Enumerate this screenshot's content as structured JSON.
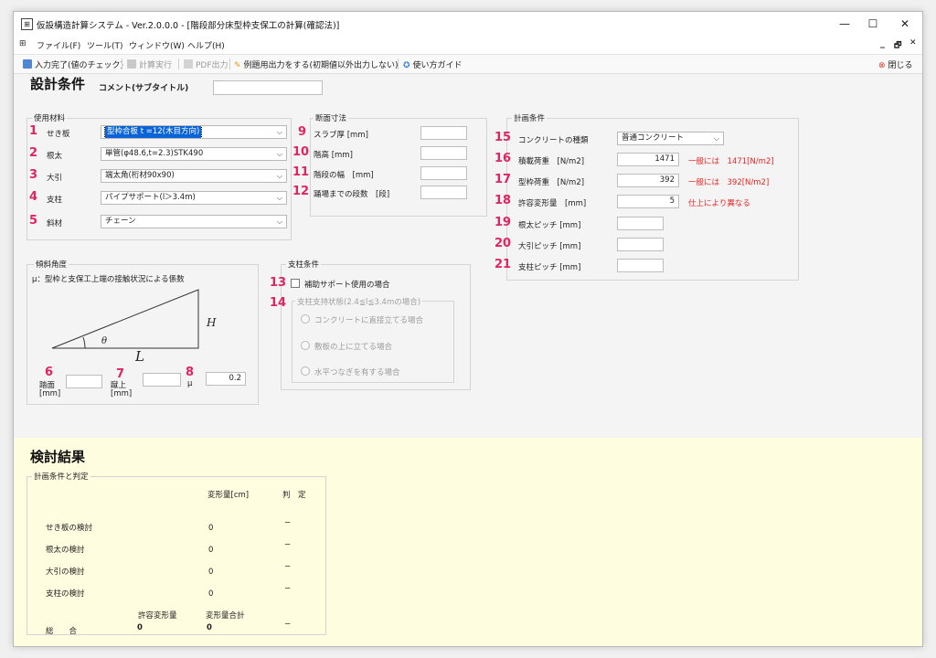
{
  "window": {
    "title": "仮設構造計算システム - Ver.2.0.0.0 - [階段部分床型枠支保工の計算(確認法)]",
    "minimize": "—",
    "maximize": "☐",
    "close": "✕"
  },
  "menu": {
    "items": [
      "ファイル(F)",
      "ツール(T)",
      "ウィンドウ(W)",
      "ヘルプ(H)"
    ],
    "right_min": "_",
    "right_restore": "🗗",
    "right_close": "✕"
  },
  "toolbar": {
    "input_done": "入力完了(値のチェック)",
    "calc_run": "計算実行",
    "pdf_out": "PDF出力",
    "example_out": "例題用出力をする(初期値以外出力しない)",
    "usage_guide": "使い方ガイド",
    "close": "閉じる"
  },
  "design": {
    "heading": "設計条件",
    "comment_label": "コメント(サブタイトル)",
    "comment_value": ""
  },
  "materials": {
    "group_title": "使用材料",
    "rows": [
      {
        "num": "1",
        "label": "せき板",
        "value": "型枠合板 t =12(木目方向)"
      },
      {
        "num": "2",
        "label": "根太",
        "value": "単管(φ48.6,t=2.3)STK490"
      },
      {
        "num": "3",
        "label": "大引",
        "value": "端太角(桁材90x90)"
      },
      {
        "num": "4",
        "label": "支柱",
        "value": "パイプサポート(l＞3.4m)"
      },
      {
        "num": "5",
        "label": "斜材",
        "value": "チェーン"
      }
    ]
  },
  "section": {
    "group_title": "断面寸法",
    "rows": [
      {
        "num": "9",
        "label": "スラブ厚 [mm]",
        "value": ""
      },
      {
        "num": "10",
        "label": "階高 [mm]",
        "value": ""
      },
      {
        "num": "11",
        "label": "階段の幅　[mm]",
        "value": ""
      },
      {
        "num": "12",
        "label": "踊場までの段数　[段]",
        "value": ""
      }
    ]
  },
  "plan": {
    "group_title": "計画条件",
    "concrete": {
      "num": "15",
      "label": "コンクリートの種類",
      "value": "普通コンクリート"
    },
    "rows": [
      {
        "num": "16",
        "label": "積載荷重　[N/m2]",
        "value": "1471",
        "note": "一般には　1471[N/m2]"
      },
      {
        "num": "17",
        "label": "型枠荷重　[N/m2]",
        "value": "392",
        "note": "一般には　392[N/m2]"
      },
      {
        "num": "18",
        "label": "許容変形量　[mm]",
        "value": "5",
        "note": "仕上により異なる"
      },
      {
        "num": "19",
        "label": "根太ピッチ [mm]",
        "value": "",
        "note": ""
      },
      {
        "num": "20",
        "label": "大引ピッチ [mm]",
        "value": "",
        "note": ""
      },
      {
        "num": "21",
        "label": "支柱ピッチ [mm]",
        "value": "",
        "note": ""
      }
    ]
  },
  "slope": {
    "group_title": "傾斜角度",
    "desc": "μ：型枠と支保工上端の接触状況による係数",
    "theta": "θ",
    "L": "L",
    "H": "H",
    "fields": [
      {
        "num": "6",
        "label": "踏面",
        "unit": "[mm]",
        "value": ""
      },
      {
        "num": "7",
        "label": "蹴上",
        "unit": "[mm]",
        "value": ""
      },
      {
        "num": "8",
        "label": "μ",
        "unit": "",
        "value": "0.2"
      }
    ]
  },
  "support": {
    "group_title": "支柱条件",
    "n13": "13",
    "n14": "14",
    "aux_label": "補助サポート使用の場合",
    "sub_title": "支柱支持状態(2.4≦l≦3.4mの場合)",
    "options": [
      "コンクリートに直接立てる場合",
      "敷板の上に立てる場合",
      "水平つなぎを有する場合"
    ]
  },
  "results": {
    "heading": "検討結果",
    "group_title": "計画条件と判定",
    "col_deform": "変形量[cm]",
    "col_judge": "判　定",
    "rows": [
      {
        "label": "せき板の検討",
        "value": "0",
        "judge": "−"
      },
      {
        "label": "根太の検討",
        "value": "0",
        "judge": "−"
      },
      {
        "label": "大引の検討",
        "value": "0",
        "judge": "−"
      },
      {
        "label": "支柱の検討",
        "value": "0",
        "judge": "−"
      }
    ],
    "allow_label": "許容変形量",
    "sum_label": "変形量合計",
    "total_label": "総　　合",
    "allow_value": "0",
    "sum_value": "0",
    "total_judge": "−"
  }
}
